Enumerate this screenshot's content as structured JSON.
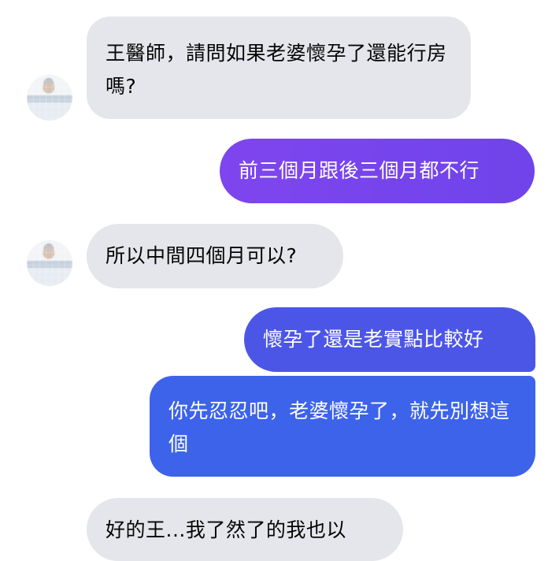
{
  "messages": [
    {
      "id": "m1",
      "side": "incoming",
      "text": "王醫師，請問如果老婆懷孕了還能行房嗎?"
    },
    {
      "id": "m2",
      "side": "outgoing",
      "text": "前三個月跟後三個月都不行"
    },
    {
      "id": "m3",
      "side": "incoming",
      "text": "所以中間四個月可以?"
    },
    {
      "id": "m4",
      "side": "outgoing",
      "text": "懷孕了還是老實點比較好"
    },
    {
      "id": "m5",
      "side": "outgoing",
      "text": "你先忍忍吧，老婆懷孕了，就先別想這個"
    },
    {
      "id": "m6",
      "side": "incoming",
      "text": "好的王...我了然了的我也以"
    }
  ],
  "colors": {
    "incoming_bg": "#e4e6eb",
    "incoming_text": "#050505",
    "outgoing_purple": "#7a3ff0",
    "outgoing_blue_purple": "#4c56e6",
    "outgoing_blue": "#3d63ea",
    "outgoing_text": "#ffffff"
  },
  "icons": {
    "avatar": "blurred-user-avatar"
  }
}
